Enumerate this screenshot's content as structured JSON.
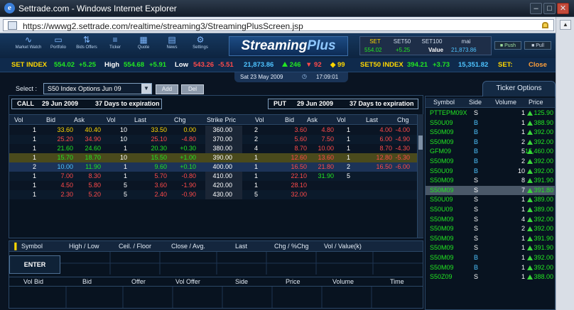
{
  "window": {
    "title": "Settrade.com - Windows Internet Explorer",
    "url": "https://wwwg2.settrade.com/realtime/streaming3/StreamingPlusScreen.jsp"
  },
  "toolbar": {
    "items": [
      "Market Watch",
      "Portfolio",
      "Bids Offers",
      "Ticker",
      "Quote",
      "News",
      "Settings"
    ],
    "logo_main": "Streaming",
    "logo_plus": "Plus",
    "index_heads": [
      "SET",
      "SET50",
      "SET100",
      "mai"
    ],
    "set_value": "554.02",
    "set_change": "+5.25",
    "value_label": "Value",
    "value": "21,873.86",
    "push": "Push",
    "pull": "Pull"
  },
  "ticker": {
    "set_index_label": "SET INDEX",
    "set_index": "554.02",
    "set_index_chg": "+5.25",
    "high_label": "High",
    "high": "554.68",
    "high_chg": "+5.91",
    "low_label": "Low",
    "low": "543.26",
    "low_chg": "-5.51",
    "value": "21,873.86",
    "up_count": "246",
    "down_count": "92",
    "unch_count": "99",
    "set50_label": "SET50 INDEX",
    "set50": "394.21",
    "set50_chg": "+3.73",
    "set50_value": "15,351.82",
    "status_label": "SET:",
    "status": "Close"
  },
  "datebar": {
    "date": "Sat 23 May 2009",
    "time": "17:09:01"
  },
  "select": {
    "label": "Select :",
    "value": "S50 Index Options Jun 09",
    "add": "Add",
    "del": "Del"
  },
  "options": {
    "call": {
      "label": "CALL",
      "date": "29 Jun 2009",
      "days": "37 Days to expiration"
    },
    "put": {
      "label": "PUT",
      "date": "29 Jun 2009",
      "days": "37 Days to expiration"
    },
    "headers": [
      "Vol",
      "Bid",
      "Ask",
      "Vol",
      "Last",
      "Chg",
      "Strike Pric",
      "Vol",
      "Bid",
      "Ask",
      "Vol",
      "Last",
      "Chg"
    ],
    "rows": [
      {
        "cvol": "1",
        "cbid": "33.60",
        "cask": "40.40",
        "cavol": "10",
        "clast": "33.50",
        "cchg": "0.00",
        "strike": "360.00",
        "pvol": "2",
        "pbid": "3.60",
        "pask": "4.80",
        "pavol": "1",
        "plast": "4.00",
        "pchg": "-4.00"
      },
      {
        "cvol": "1",
        "cbid": "25.20",
        "cask": "34.90",
        "cavol": "10",
        "clast": "25.10",
        "cchg": "-4.80",
        "strike": "370.00",
        "pvol": "2",
        "pbid": "5.60",
        "pask": "7.50",
        "pavol": "1",
        "plast": "6.00",
        "pchg": "-4.90"
      },
      {
        "cvol": "1",
        "cbid": "21.60",
        "cask": "24.60",
        "cavol": "1",
        "clast": "20.30",
        "cchg": "+0.30",
        "strike": "380.00",
        "pvol": "4",
        "pbid": "8.70",
        "pask": "10.00",
        "pavol": "1",
        "plast": "8.70",
        "pchg": "-4.30"
      },
      {
        "cvol": "1",
        "cbid": "15.70",
        "cask": "18.70",
        "cavol": "10",
        "clast": "15.50",
        "cchg": "+1.00",
        "strike": "390.00",
        "pvol": "1",
        "pbid": "12.60",
        "pask": "13.60",
        "pavol": "1",
        "plast": "12.80",
        "pchg": "-5.30"
      },
      {
        "cvol": "2",
        "cbid": "10.00",
        "cask": "11.90",
        "cavol": "1",
        "clast": "9.60",
        "cchg": "+0.10",
        "strike": "400.00",
        "pvol": "1",
        "pbid": "16.50",
        "pask": "21.80",
        "pavol": "2",
        "plast": "16.50",
        "pchg": "-6.00"
      },
      {
        "cvol": "1",
        "cbid": "7.00",
        "cask": "8.30",
        "cavol": "1",
        "clast": "5.70",
        "cchg": "-0.80",
        "strike": "410.00",
        "pvol": "1",
        "pbid": "22.10",
        "pask": "31.90",
        "pavol": "5",
        "plast": "",
        "pchg": ""
      },
      {
        "cvol": "1",
        "cbid": "4.50",
        "cask": "5.80",
        "cavol": "5",
        "clast": "3.60",
        "cchg": "-1.90",
        "strike": "420.00",
        "pvol": "1",
        "pbid": "28.10",
        "pask": "",
        "pavol": "",
        "plast": "",
        "pchg": ""
      },
      {
        "cvol": "1",
        "cbid": "2.30",
        "cask": "5.20",
        "cavol": "5",
        "clast": "2.40",
        "cchg": "-0.90",
        "strike": "430.00",
        "pvol": "5",
        "pbid": "32.00",
        "pask": "",
        "pavol": "",
        "plast": "",
        "pchg": ""
      }
    ]
  },
  "symbol_panel": {
    "headers": [
      "Symbol",
      "High / Low",
      "Ceil. / Floor",
      "Close / Avg.",
      "Last",
      "Chg / %Chg",
      "Vol / Value(k)"
    ],
    "enter": "ENTER",
    "book_headers": [
      "Vol Bid",
      "Bid",
      "Offer",
      "Vol Offer",
      "Side",
      "Price",
      "Volume",
      "Time"
    ]
  },
  "ticker_options": {
    "tab": "Ticker Options",
    "headers": [
      "Symbol",
      "Side",
      "Volume",
      "Price"
    ],
    "rows": [
      {
        "sym": "PTTEPM09X",
        "side": "S",
        "vol": "1",
        "price": "125.90"
      },
      {
        "sym": "S50U09",
        "side": "B",
        "vol": "1",
        "price": "388.90"
      },
      {
        "sym": "S50M09",
        "side": "B",
        "vol": "1",
        "price": "392.00"
      },
      {
        "sym": "S50M09",
        "side": "B",
        "vol": "2",
        "price": "392.00"
      },
      {
        "sym": "GFM09",
        "side": "B",
        "vol": "5",
        "price": "15,460.00"
      },
      {
        "sym": "S50M09",
        "side": "B",
        "vol": "2",
        "price": "392.00"
      },
      {
        "sym": "S50U09",
        "side": "B",
        "vol": "10",
        "price": "392.00"
      },
      {
        "sym": "S50M09",
        "side": "S",
        "vol": "8",
        "price": "391.90"
      },
      {
        "sym": "S50M09",
        "side": "S",
        "vol": "7",
        "price": "391.80"
      },
      {
        "sym": "S50U09",
        "side": "S",
        "vol": "1",
        "price": "389.00"
      },
      {
        "sym": "S50U09",
        "side": "S",
        "vol": "1",
        "price": "389.00"
      },
      {
        "sym": "S50M09",
        "side": "S",
        "vol": "4",
        "price": "392.00"
      },
      {
        "sym": "S50M09",
        "side": "S",
        "vol": "2",
        "price": "392.00"
      },
      {
        "sym": "S50M09",
        "side": "S",
        "vol": "1",
        "price": "391.90"
      },
      {
        "sym": "S50M09",
        "side": "S",
        "vol": "1",
        "price": "391.90"
      },
      {
        "sym": "S50M09",
        "side": "B",
        "vol": "1",
        "price": "392.00"
      },
      {
        "sym": "S50M09",
        "side": "B",
        "vol": "1",
        "price": "392.00"
      },
      {
        "sym": "S50Z09",
        "side": "S",
        "vol": "1",
        "price": "388.00"
      }
    ]
  }
}
